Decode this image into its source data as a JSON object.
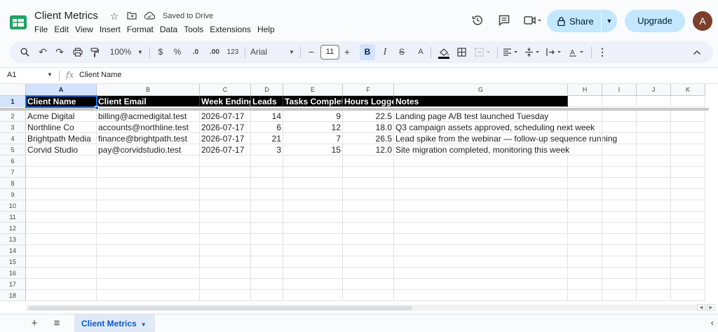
{
  "doc": {
    "title": "Client Metrics",
    "saved_status": "Saved to Drive",
    "menu": [
      "File",
      "Edit",
      "View",
      "Insert",
      "Format",
      "Data",
      "Tools",
      "Extensions",
      "Help"
    ]
  },
  "header_actions": {
    "share_label": "Share",
    "upgrade_label": "Upgrade",
    "avatar_initial": "A"
  },
  "toolbar": {
    "zoom": "100%",
    "currency": "$",
    "percent": "%",
    "dec_decrease": ".0",
    "dec_increase": ".00",
    "number_format": "123",
    "font": "Arial",
    "font_size": "11",
    "minus": "−",
    "plus": "+",
    "bold": "B",
    "italic": "I",
    "strike": "S",
    "text_color": "A"
  },
  "formula_bar": {
    "cell_ref": "A1",
    "fx": "fx",
    "value": "Client Name"
  },
  "grid": {
    "columns": [
      "A",
      "B",
      "C",
      "D",
      "E",
      "F",
      "G",
      "H",
      "I",
      "J",
      "K"
    ],
    "row_numbers": [
      "1",
      "2",
      "3",
      "4",
      "5",
      "6",
      "7",
      "8",
      "9",
      "10",
      "11",
      "12",
      "13",
      "14",
      "15",
      "16",
      "17",
      "18"
    ],
    "header_row": [
      "Client Name",
      "Client Email",
      "Week Ending",
      "Leads",
      "Tasks Completed",
      "Hours Logged",
      "Notes"
    ],
    "rows": [
      [
        "Acme Digital",
        "billing@acmedigital.test",
        "2026-07-17",
        "14",
        "9",
        "22.5",
        "Landing page A/B test launched Tuesday"
      ],
      [
        "Northline Co",
        "accounts@northline.test",
        "2026-07-17",
        "6",
        "12",
        "18.0",
        "Q3 campaign assets approved, scheduling next week"
      ],
      [
        "Brightpath Media",
        "finance@brightpath.test",
        "2026-07-17",
        "21",
        "7",
        "26.5",
        "Lead spike from the webinar — follow-up sequence running"
      ],
      [
        "Corvid Studio",
        "pay@corvidstudio.test",
        "2026-07-17",
        "3",
        "15",
        "12.0",
        "Site migration completed, monitoring this week"
      ]
    ]
  },
  "sheets": {
    "active": "Client Metrics"
  },
  "colors": {
    "accent": "#1a73e8",
    "share_bg": "#c2e7ff",
    "header_fill": "#000000",
    "avatar": "#7b3f2c"
  }
}
